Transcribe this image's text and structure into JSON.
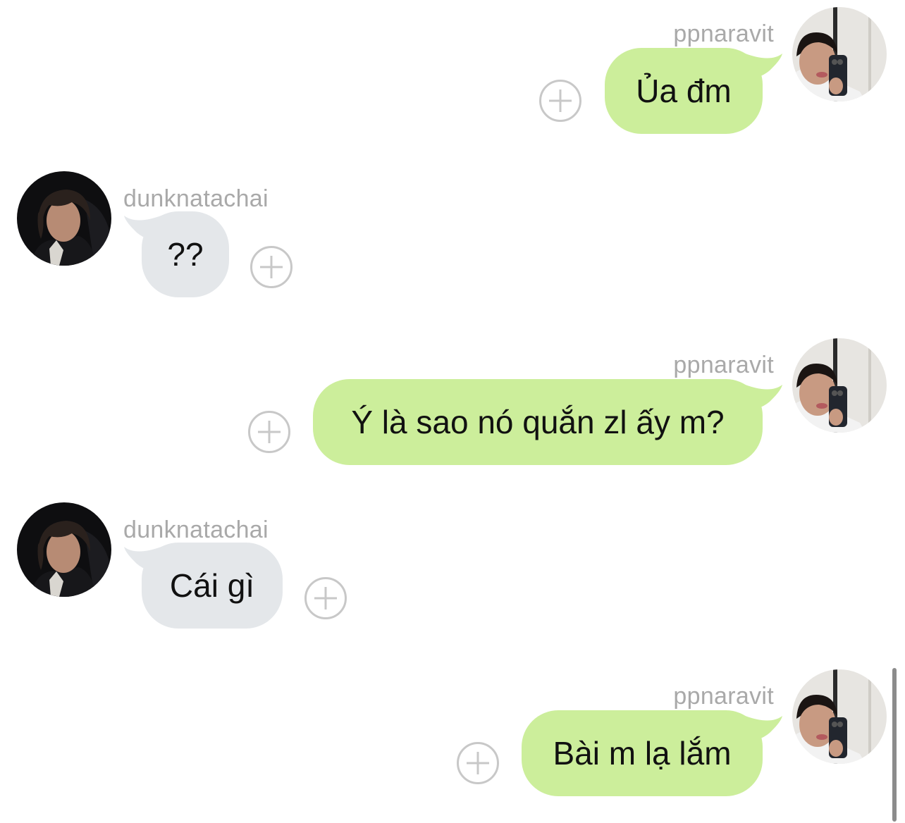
{
  "messages": [
    {
      "sender": "ppnaravit",
      "direction": "out",
      "text": "Ủa đm"
    },
    {
      "sender": "dunknatachai",
      "direction": "in",
      "text": "??"
    },
    {
      "sender": "ppnaravit",
      "direction": "out",
      "text": "Ý là sao nó quắn zl ấy m?"
    },
    {
      "sender": "dunknatachai",
      "direction": "in",
      "text": "Cái gì"
    },
    {
      "sender": "ppnaravit",
      "direction": "out",
      "text": "Bài m lạ lắm"
    }
  ],
  "icons": {
    "add_reaction": "plus-circle-icon",
    "avatar": "profile-photo"
  },
  "colors": {
    "outgoing_bubble": "#ccee9b",
    "incoming_bubble": "#e4e7ea",
    "username": "#a9a9a9",
    "add_button_stroke": "#c8c8c8",
    "scrollbar": "#8c8c8c"
  }
}
